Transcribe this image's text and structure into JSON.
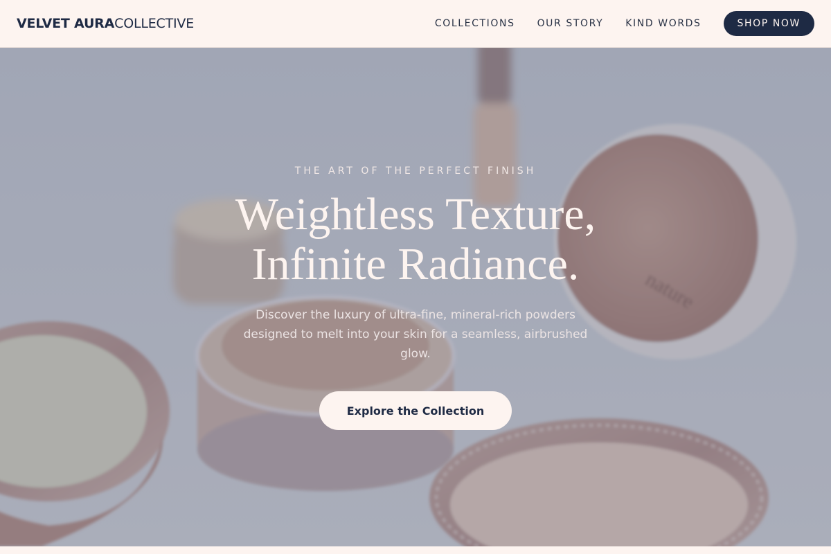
{
  "brand": {
    "name_bold": "VELVET AURA",
    "name_light": "COLLECTIVE"
  },
  "nav": {
    "links": [
      "COLLECTIONS",
      "OUR STORY",
      "KIND WORDS"
    ],
    "shop_label": "SHOP NOW"
  },
  "hero": {
    "eyebrow": "THE ART OF THE PERFECT FINISH",
    "headline_line1": "Weightless Texture,",
    "headline_line2": "Infinite Radiance.",
    "subtext": "Discover the luxury of ultra-fine, mineral-rich powders designed to melt into your skin for a seamless, airbrushed glow.",
    "cta_label": "Explore the Collection",
    "lid_text": "nature"
  },
  "colors": {
    "navy": "#1e2a44",
    "cream": "#fdf4f0",
    "overlay": "#626880"
  }
}
